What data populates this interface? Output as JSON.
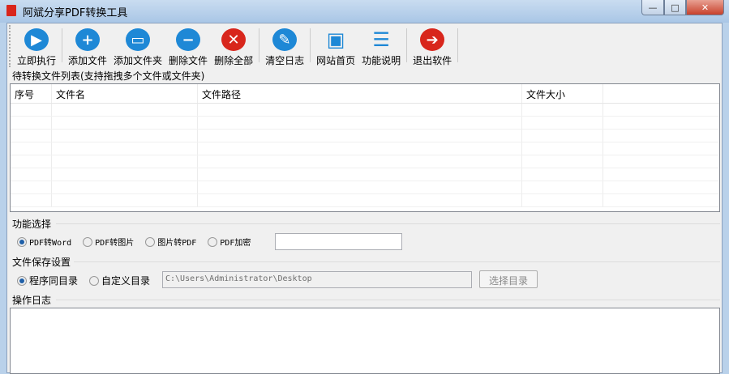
{
  "window": {
    "title": "阿斌分享PDF转换工具",
    "minimize": "—",
    "maximize": "□",
    "close": "✕"
  },
  "toolbar": [
    {
      "label": "立即执行",
      "icon": "play-icon",
      "glyph": "▶"
    },
    {
      "label": "添加文件",
      "icon": "plus-icon",
      "glyph": "+"
    },
    {
      "label": "添加文件夹",
      "icon": "folder-icon",
      "glyph": "▭"
    },
    {
      "label": "删除文件",
      "icon": "minus-icon",
      "glyph": "−"
    },
    {
      "label": "删除全部",
      "icon": "close-circle-icon",
      "glyph": "✕"
    },
    {
      "label": "清空日志",
      "icon": "broom-icon",
      "glyph": "✎"
    },
    {
      "label": "网站首页",
      "icon": "monitor-icon",
      "glyph": "▣"
    },
    {
      "label": "功能说明",
      "icon": "document-icon",
      "glyph": "☰"
    },
    {
      "label": "退出软件",
      "icon": "exit-icon",
      "glyph": "➔"
    }
  ],
  "file_list": {
    "label": "待转换文件列表(支持拖拽多个文件或文件夹)",
    "columns": [
      "序号",
      "文件名",
      "文件路径",
      "文件大小"
    ]
  },
  "function": {
    "label": "功能选择",
    "options": [
      "PDF转Word",
      "PDF转图片",
      "图片转PDF",
      "PDF加密"
    ],
    "selected": "PDF转Word",
    "password_value": ""
  },
  "save": {
    "label": "文件保存设置",
    "options": [
      "程序同目录",
      "自定义目录"
    ],
    "selected": "程序同目录",
    "path": "C:\\Users\\Administrator\\Desktop",
    "choose_button": "选择目录"
  },
  "log": {
    "label": "操作日志"
  }
}
